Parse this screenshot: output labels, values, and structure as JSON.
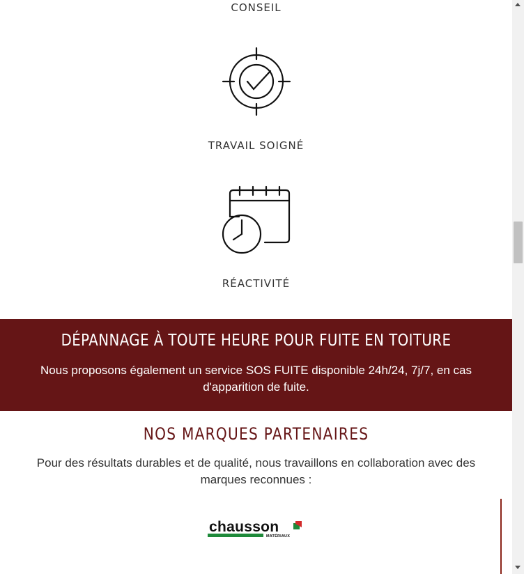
{
  "features": {
    "conseil": {
      "label": "CONSEIL"
    },
    "travail": {
      "label": "TRAVAIL SOIGNÉ",
      "icon": "target-check-icon"
    },
    "reactivite": {
      "label": "RÉACTIVITÉ",
      "icon": "calendar-clock-icon"
    }
  },
  "banner": {
    "title": "DÉPANNAGE À TOUTE HEURE POUR FUITE EN TOITURE",
    "text": "Nous proposons également un service SOS FUITE disponible 24h/24, 7j/7, en cas d'apparition de fuite.",
    "background": "#651516"
  },
  "partners": {
    "title": "NOS MARQUES PARTENAIRES",
    "text": "Pour des résultats durables et de qualité, nous travaillons en collaboration avec des marques reconnues :",
    "logo": {
      "name": "chausson",
      "subtitle": "MATÉRIAUX",
      "accent": "#1e8a3a",
      "mark_color": "#d22a2a"
    }
  },
  "colors": {
    "accent": "#651516",
    "text": "#333333"
  }
}
